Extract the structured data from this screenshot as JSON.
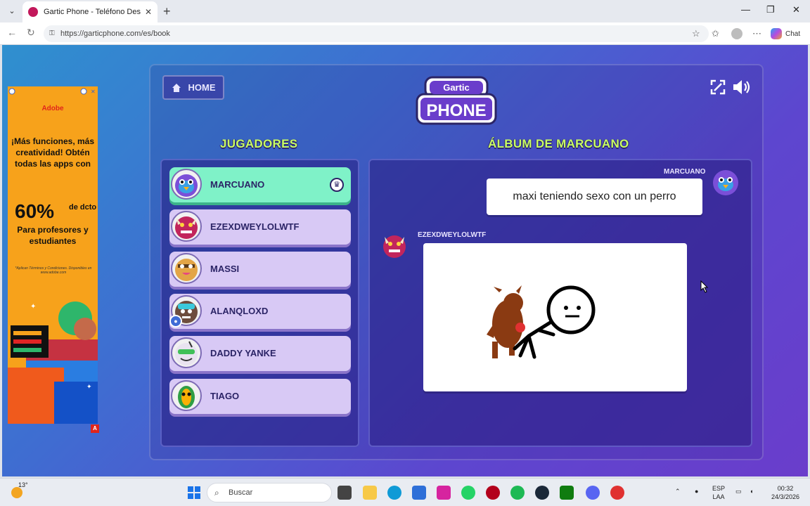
{
  "browser": {
    "tab_title": "Gartic Phone - Teléfono Descompuesto",
    "tab_close": "✕",
    "new_tab": "+",
    "url": "https://garticphone.com/es/book",
    "chat_label": "Chat",
    "window_controls": [
      "—",
      "❐",
      "✕"
    ]
  },
  "ad": {
    "brand": "Adobe",
    "headline": "¡Más funciones, más creatividad! Obtén todas las apps con",
    "percent": "60%",
    "percent_suffix": "de dcto",
    "subline": "Para profesores y estudiantes",
    "fine_print": "*Aplican Términos y Condiciones. Disponibles en www.adobe.com",
    "badge": "A"
  },
  "header": {
    "home_label": "HOME",
    "logo_top": "Gartic",
    "logo_bottom": "PHONE"
  },
  "players_title": "JUGADORES",
  "players": [
    {
      "name": "MARCUANO",
      "host": true
    },
    {
      "name": "EZEXDWEYLOLWTF",
      "host": false
    },
    {
      "name": "MASSI",
      "host": false
    },
    {
      "name": "ALANQLOXD",
      "host": false
    },
    {
      "name": "DADDY YANKE",
      "host": false
    },
    {
      "name": "TIAGO",
      "host": false
    }
  ],
  "album": {
    "title": "ÁLBUM DE MARCUANO",
    "entries": [
      {
        "author": "MARCUANO",
        "type": "text",
        "text": "maxi teniendo sexo con un perro"
      },
      {
        "author": "EZEXDWEYLOLWTF",
        "type": "drawing"
      }
    ]
  },
  "taskbar": {
    "temperature": "13°",
    "search_placeholder": "Buscar",
    "lang_top": "ESP",
    "lang_bottom": "LAA",
    "time": "00:32",
    "date": "24/3/2026"
  },
  "colors": {
    "accent_green": "#c9ff63",
    "host_row": "#7ff2c8",
    "player_row": "#d8c9f5"
  }
}
